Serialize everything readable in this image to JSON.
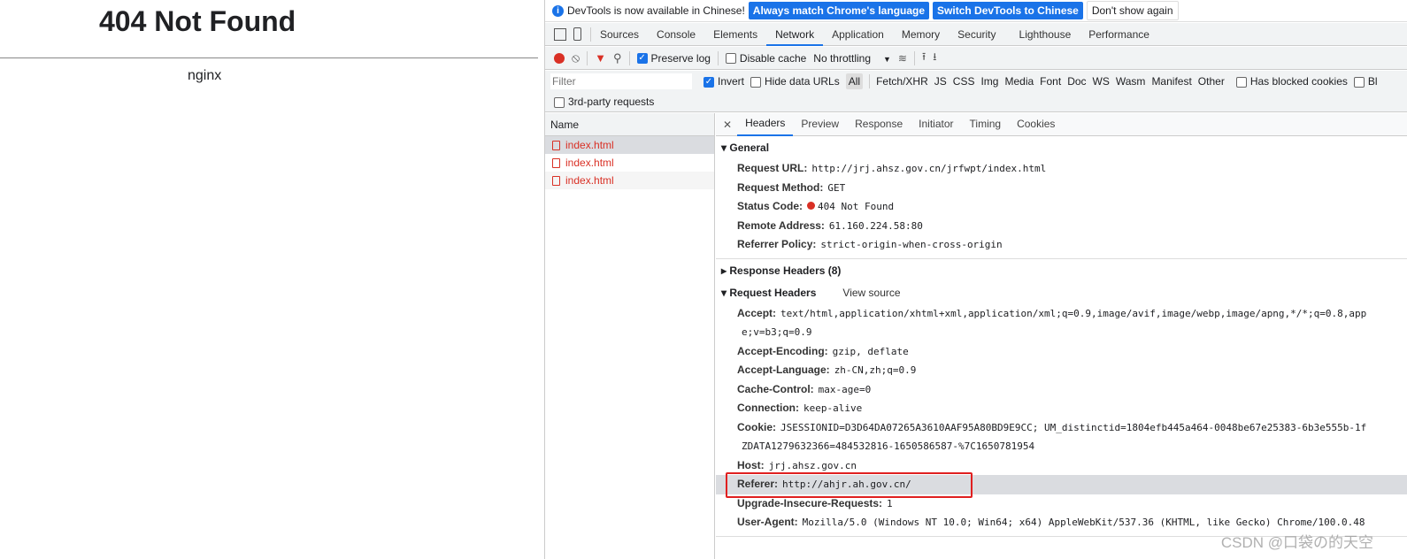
{
  "page": {
    "title": "404 Not Found",
    "server": "nginx"
  },
  "infobar": {
    "message": "DevTools is now available in Chinese!",
    "btn_match": "Always match Chrome's language",
    "btn_switch": "Switch DevTools to Chinese",
    "btn_dismiss": "Don't show again"
  },
  "tabs": [
    "Sources",
    "Console",
    "Elements",
    "Network",
    "Application",
    "Memory",
    "Security",
    "Lighthouse",
    "Performance"
  ],
  "active_tab": "Network",
  "toolbar": {
    "preserve_log": "Preserve log",
    "disable_cache": "Disable cache",
    "throttling": "No throttling"
  },
  "filter": {
    "placeholder": "Filter",
    "invert": "Invert",
    "hide_data_urls": "Hide data URLs",
    "types": [
      "All",
      "Fetch/XHR",
      "JS",
      "CSS",
      "Img",
      "Media",
      "Font",
      "Doc",
      "WS",
      "Wasm",
      "Manifest",
      "Other"
    ],
    "has_blocked_cookies": "Has blocked cookies",
    "blocked": "Bl",
    "third_party": "3rd-party requests"
  },
  "requests": {
    "header": "Name",
    "items": [
      "index.html",
      "index.html",
      "index.html"
    ]
  },
  "detail_tabs": [
    "Headers",
    "Preview",
    "Response",
    "Initiator",
    "Timing",
    "Cookies"
  ],
  "general": {
    "title": "General",
    "rows": [
      {
        "k": "Request URL:",
        "v": "http://jrj.ahsz.gov.cn/jrfwpt/index.html"
      },
      {
        "k": "Request Method:",
        "v": "GET"
      },
      {
        "k": "Status Code:",
        "v": "404 Not Found"
      },
      {
        "k": "Remote Address:",
        "v": "61.160.224.58:80"
      },
      {
        "k": "Referrer Policy:",
        "v": "strict-origin-when-cross-origin"
      }
    ]
  },
  "response_headers": {
    "title": "Response Headers (8)"
  },
  "request_headers": {
    "title": "Request Headers",
    "view_source": "View source",
    "rows": [
      {
        "k": "Accept:",
        "v": "text/html,application/xhtml+xml,application/xml;q=0.9,image/avif,image/webp,image/apng,*/*;q=0.8,app"
      },
      {
        "k": "",
        "v": "e;v=b3;q=0.9"
      },
      {
        "k": "Accept-Encoding:",
        "v": "gzip, deflate"
      },
      {
        "k": "Accept-Language:",
        "v": "zh-CN,zh;q=0.9"
      },
      {
        "k": "Cache-Control:",
        "v": "max-age=0"
      },
      {
        "k": "Connection:",
        "v": "keep-alive"
      },
      {
        "k": "Cookie:",
        "v": "JSESSIONID=D3D64DA07265A3610AAF95A80BD9E9CC; UM_distinctid=1804efb445a464-0048be67e25383-6b3e555b-1f"
      },
      {
        "k": "",
        "v": "ZDATA1279632366=484532816-1650586587-%7C1650781954"
      },
      {
        "k": "Host:",
        "v": "jrj.ahsz.gov.cn"
      },
      {
        "k": "Referer:",
        "v": "http://ahjr.ah.gov.cn/"
      },
      {
        "k": "Upgrade-Insecure-Requests:",
        "v": "1"
      },
      {
        "k": "User-Agent:",
        "v": "Mozilla/5.0 (Windows NT 10.0; Win64; x64) AppleWebKit/537.36 (KHTML, like Gecko) Chrome/100.0.48"
      }
    ]
  },
  "watermark": "CSDN @口袋の的天空"
}
